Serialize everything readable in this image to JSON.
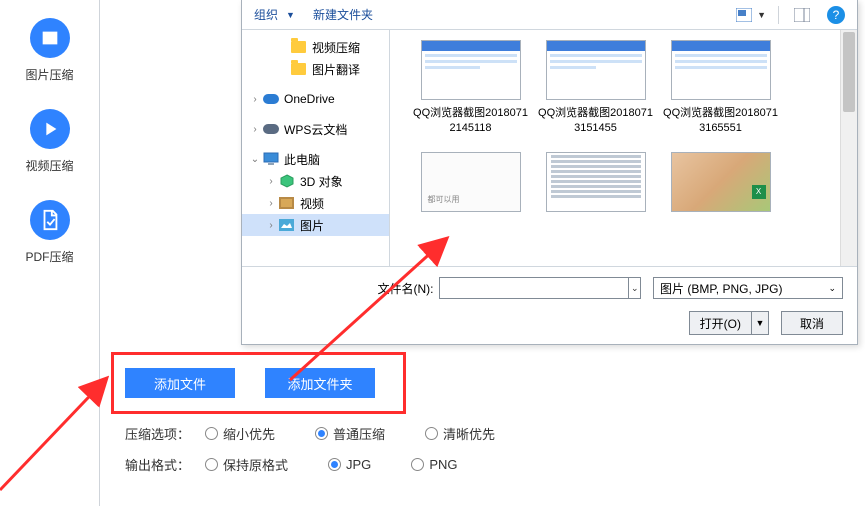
{
  "sidebar": {
    "items": [
      {
        "label": "图片压缩",
        "icon": "image"
      },
      {
        "label": "视频压缩",
        "icon": "play"
      },
      {
        "label": "PDF压缩",
        "icon": "pdf"
      }
    ]
  },
  "main": {
    "add_file_label": "添加文件",
    "add_folder_label": "添加文件夹",
    "compress_option_label": "压缩选项：",
    "output_format_label": "输出格式：",
    "compress_options": [
      {
        "label": "缩小优先",
        "selected": false
      },
      {
        "label": "普通压缩",
        "selected": true
      },
      {
        "label": "清晰优先",
        "selected": false
      }
    ],
    "format_options": [
      {
        "label": "保持原格式",
        "selected": false
      },
      {
        "label": "JPG",
        "selected": true
      },
      {
        "label": "PNG",
        "selected": false
      }
    ]
  },
  "dialog": {
    "toolbar": {
      "organize": "组织",
      "new_folder": "新建文件夹"
    },
    "tree": [
      {
        "depth": 1,
        "arrow": "",
        "icon": "folder",
        "label": "视频压缩"
      },
      {
        "depth": 1,
        "arrow": "",
        "icon": "folder",
        "label": "图片翻译"
      },
      {
        "depth": 0,
        "arrow": "›",
        "icon": "cloud",
        "label": "OneDrive"
      },
      {
        "depth": 0,
        "arrow": "›",
        "icon": "cloud",
        "label": "WPS云文档"
      },
      {
        "depth": 0,
        "arrow": "⌄",
        "icon": "pc",
        "label": "此电脑"
      },
      {
        "depth": 1,
        "arrow": "›",
        "icon": "cube",
        "label": "3D 对象"
      },
      {
        "depth": 1,
        "arrow": "›",
        "icon": "video",
        "label": "视频"
      },
      {
        "depth": 1,
        "arrow": "›",
        "icon": "image",
        "label": "图片",
        "selected": true
      }
    ],
    "files": [
      {
        "thumb": "web",
        "name": "QQ浏览器截图20180712145118"
      },
      {
        "thumb": "web",
        "name": "QQ浏览器截图20180713151455"
      },
      {
        "thumb": "web",
        "name": "QQ浏览器截图20180713165551"
      },
      {
        "thumb": "blank",
        "name": ""
      },
      {
        "thumb": "list",
        "name": ""
      },
      {
        "thumb": "nat",
        "name": ""
      }
    ],
    "filename_label": "文件名(N):",
    "filename_value": "",
    "filetype_text": "图片 (BMP, PNG, JPG)",
    "open_label": "打开(O)",
    "cancel_label": "取消"
  }
}
